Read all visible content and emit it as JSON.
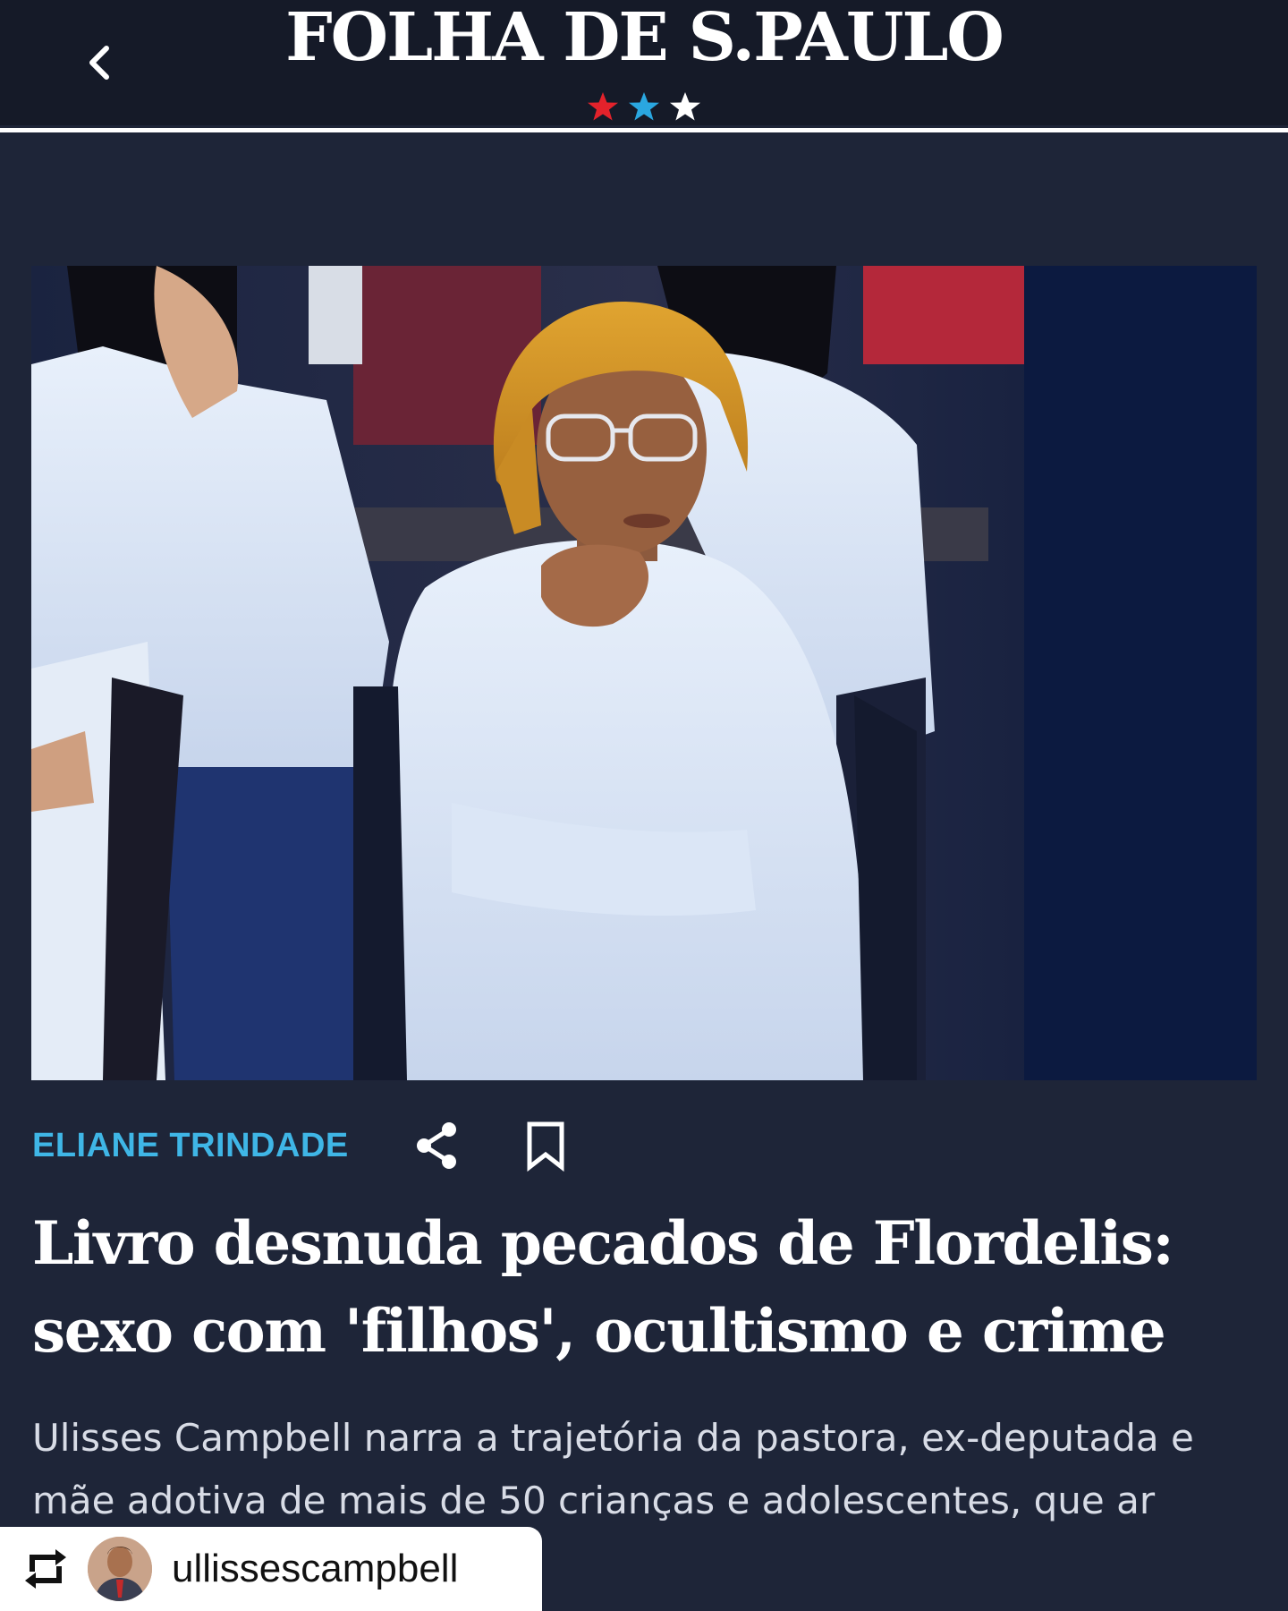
{
  "header": {
    "logo_text": "FOLHA DE S.PAULO",
    "back_icon": "chevron-left-icon",
    "stars_colors": [
      "#e3222b",
      "#2aa7e0",
      "#ffffff"
    ]
  },
  "article": {
    "hero_image_alt": "",
    "author": "ELIANE TRINDADE",
    "share_icon": "share-icon",
    "bookmark_icon": "bookmark-icon",
    "headline": "Livro desnuda pecados de Flordelis: sexo com 'filhos', ocultismo e crime",
    "dek": "Ulisses Campbell narra a trajetória da pastora, ex-deputada e mãe adotiva de mais de 50 crianças e adolescentes, que ar matar o marido"
  },
  "repost": {
    "icon": "repost-icon",
    "username": "ullissescampbell"
  },
  "colors": {
    "background": "#1e2538",
    "header": "#151a28",
    "author_accent": "#3fb6e6"
  }
}
